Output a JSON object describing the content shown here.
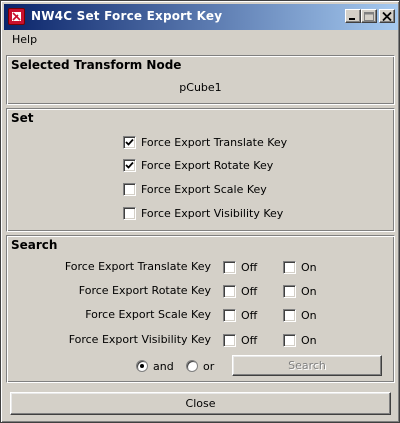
{
  "window": {
    "title": "NW4C Set Force Export Key"
  },
  "menu": {
    "help": "Help"
  },
  "selected": {
    "heading": "Selected Transform Node",
    "node": "pCube1"
  },
  "set": {
    "heading": "Set",
    "items": [
      {
        "label": "Force Export Translate Key",
        "checked": true
      },
      {
        "label": "Force Export Rotate Key",
        "checked": true
      },
      {
        "label": "Force Export Scale Key",
        "checked": false
      },
      {
        "label": "Force Export Visibility Key",
        "checked": false
      }
    ]
  },
  "search": {
    "heading": "Search",
    "off_label": "Off",
    "on_label": "On",
    "rows": [
      {
        "label": "Force Export Translate Key"
      },
      {
        "label": "Force Export Rotate Key"
      },
      {
        "label": "Force Export Scale Key"
      },
      {
        "label": "Force Export Visibility Key"
      }
    ],
    "and_label": "and",
    "or_label": "or",
    "mode": "and",
    "button": "Search"
  },
  "footer": {
    "close": "Close"
  }
}
